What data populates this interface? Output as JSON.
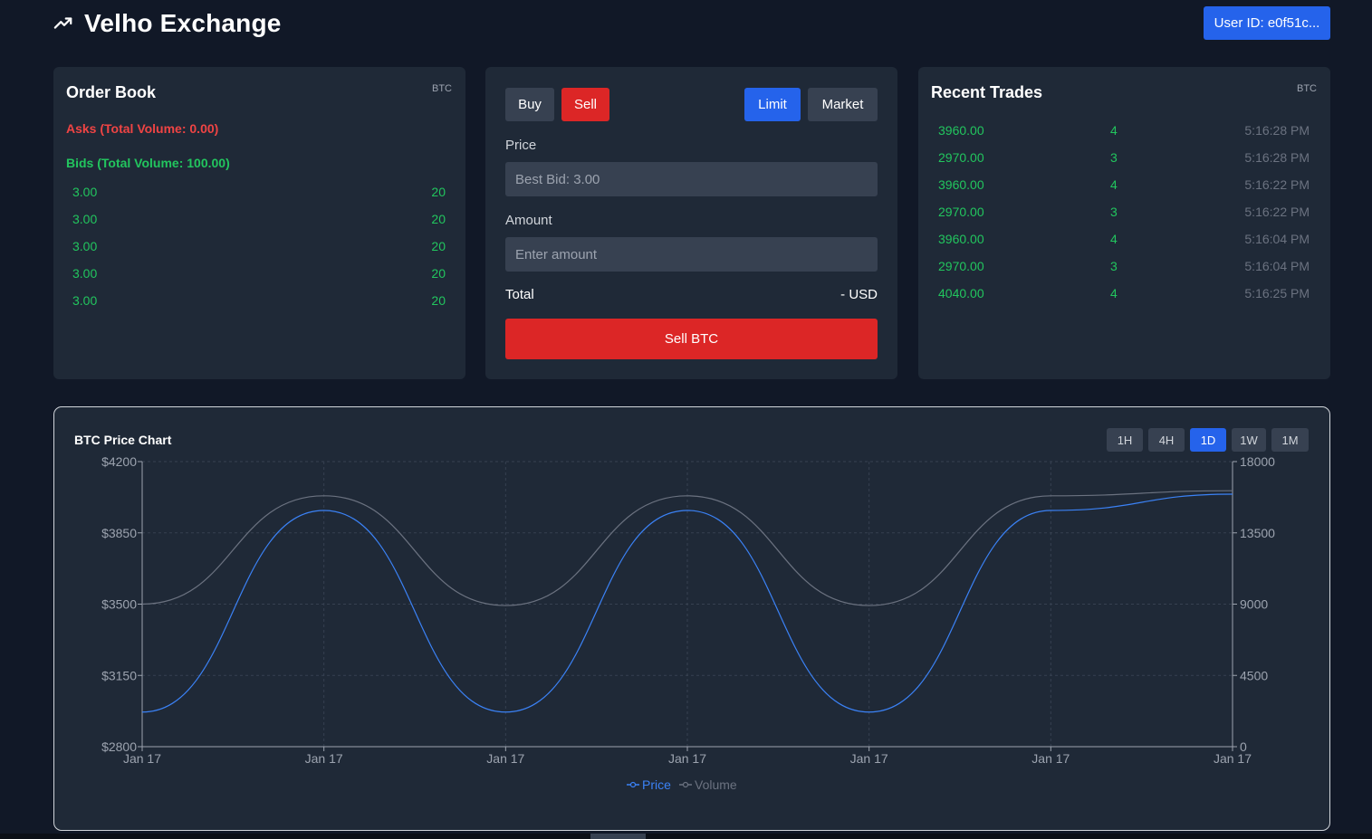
{
  "header": {
    "title": "Velho Exchange",
    "user_button": "User ID: e0f51c..."
  },
  "order_book": {
    "title": "Order Book",
    "tag": "BTC",
    "asks_label": "Asks (Total Volume: 0.00)",
    "bids_label": "Bids (Total Volume: 100.00)",
    "bids": [
      {
        "price": "3.00",
        "amount": "20"
      },
      {
        "price": "3.00",
        "amount": "20"
      },
      {
        "price": "3.00",
        "amount": "20"
      },
      {
        "price": "3.00",
        "amount": "20"
      },
      {
        "price": "3.00",
        "amount": "20"
      }
    ]
  },
  "trade_form": {
    "buy_label": "Buy",
    "sell_label": "Sell",
    "limit_label": "Limit",
    "market_label": "Market",
    "price_label": "Price",
    "price_placeholder": "Best Bid: 3.00",
    "amount_label": "Amount",
    "amount_placeholder": "Enter amount",
    "total_label": "Total",
    "total_value": "- USD",
    "submit_label": "Sell BTC"
  },
  "recent_trades": {
    "title": "Recent Trades",
    "tag": "BTC",
    "trades": [
      {
        "price": "3960.00",
        "amount": "4",
        "time": "5:16:28 PM"
      },
      {
        "price": "2970.00",
        "amount": "3",
        "time": "5:16:28 PM"
      },
      {
        "price": "3960.00",
        "amount": "4",
        "time": "5:16:22 PM"
      },
      {
        "price": "2970.00",
        "amount": "3",
        "time": "5:16:22 PM"
      },
      {
        "price": "3960.00",
        "amount": "4",
        "time": "5:16:04 PM"
      },
      {
        "price": "2970.00",
        "amount": "3",
        "time": "5:16:04 PM"
      },
      {
        "price": "4040.00",
        "amount": "4",
        "time": "5:16:25 PM"
      }
    ]
  },
  "chart_panel": {
    "title": "BTC Price Chart",
    "timeframes": [
      "1H",
      "4H",
      "1D",
      "1W",
      "1M"
    ],
    "active_timeframe": "1D"
  },
  "colors": {
    "price_line": "#3b82f6",
    "volume_line": "#6b7280",
    "accent": "#2563eb",
    "sell": "#dc2626",
    "positive": "#22c55e"
  },
  "chart_data": {
    "type": "line",
    "x": [
      "Jan 17",
      "Jan 17",
      "Jan 17",
      "Jan 17",
      "Jan 17",
      "Jan 17",
      "Jan 17"
    ],
    "series": [
      {
        "name": "Price",
        "axis": "left",
        "values": [
          2970,
          3960,
          2970,
          3960,
          2970,
          3960,
          4040
        ]
      },
      {
        "name": "Volume",
        "axis": "right",
        "values": [
          9000,
          15840,
          8910,
          15840,
          8910,
          15840,
          16160
        ]
      }
    ],
    "y_left": {
      "ticks": [
        "$2800",
        "$3150",
        "$3500",
        "$3850",
        "$4200"
      ],
      "lim": [
        2800,
        4200
      ]
    },
    "y_right": {
      "ticks": [
        "0",
        "4500",
        "9000",
        "13500",
        "18000"
      ],
      "lim": [
        0,
        18000
      ]
    },
    "grid": true,
    "legend": "bottom"
  }
}
